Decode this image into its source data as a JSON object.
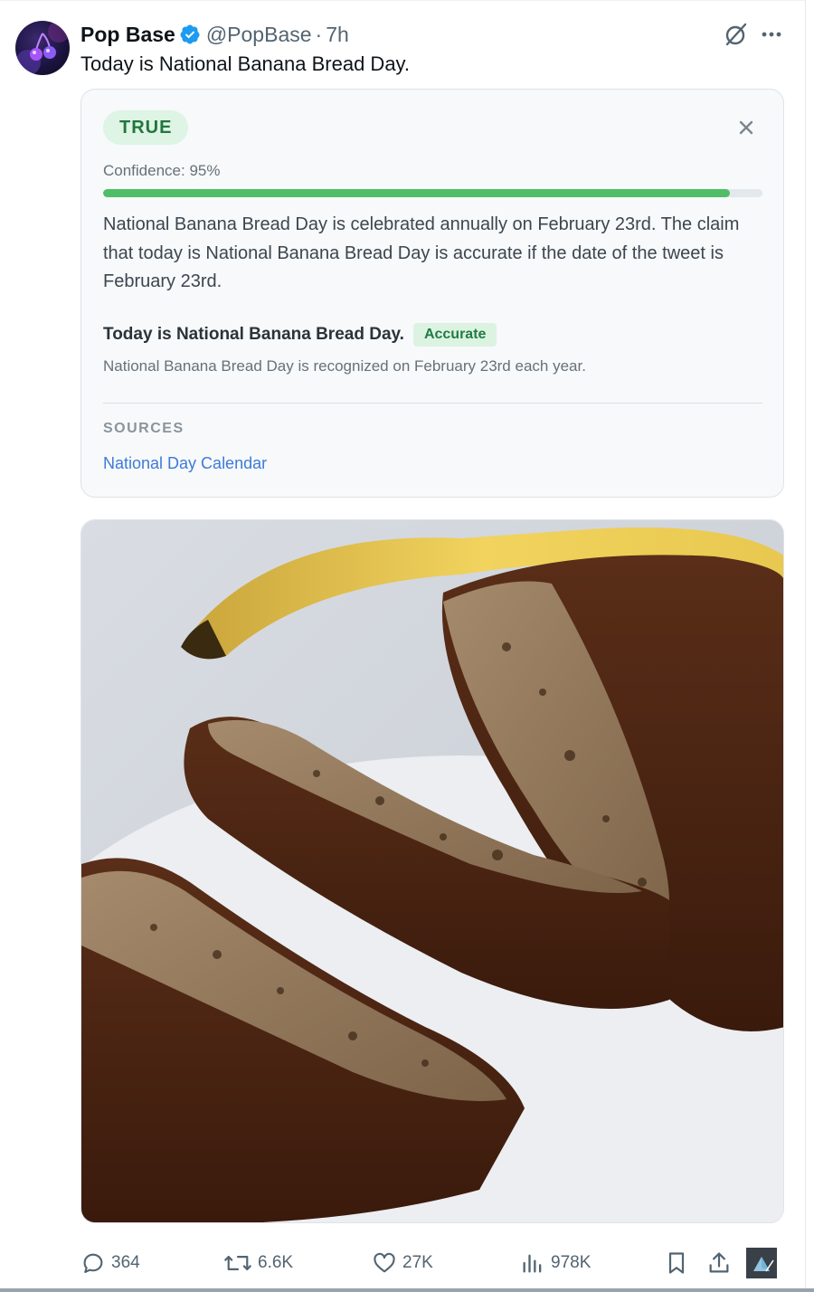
{
  "tweet": {
    "author_name": "Pop Base",
    "handle": "@PopBase",
    "separator": "·",
    "time": "7h",
    "text": "Today is National Banana Bread Day."
  },
  "fact_check": {
    "verdict": "TRUE",
    "confidence_label": "Confidence: 95%",
    "confidence": 0.95,
    "summary": "National Banana Bread Day is celebrated annually on February 23rd. The claim that today is National Banana Bread Day is accurate if the date of the tweet is February 23rd.",
    "claim": {
      "text": "Today is National Banana Bread Day.",
      "badge": "Accurate",
      "detail": "National Banana Bread Day is recognized on February 23rd each year."
    },
    "sources_title": "SOURCES",
    "sources": [
      {
        "label": "National Day Calendar"
      }
    ]
  },
  "actions": {
    "replies": "364",
    "reposts": "6.6K",
    "likes": "27K",
    "views": "978K"
  },
  "colors": {
    "verdict_bg": "#def4e4",
    "verdict_text": "#21763f",
    "bar_fill": "#4fbe67",
    "link": "#3d7bd8",
    "verified": "#1d9bf0"
  },
  "icons": [
    "verified-badge-icon",
    "grok-icon",
    "more-icon",
    "close-icon",
    "reply-icon",
    "repost-icon",
    "like-icon",
    "views-icon",
    "bookmark-icon",
    "share-icon"
  ]
}
